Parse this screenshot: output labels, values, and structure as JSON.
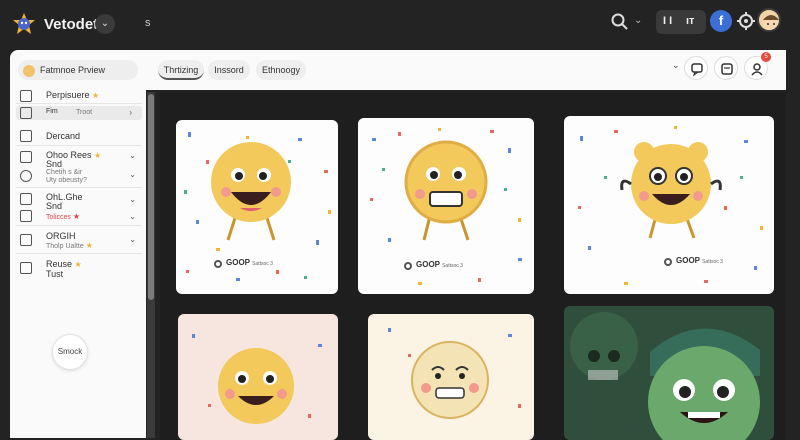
{
  "app": {
    "title": "Vetodet",
    "chev": "⌄",
    "s_label": "s"
  },
  "topbar": {
    "ii": "I I",
    "tt": "ıт",
    "fb": "f"
  },
  "sidebar": {
    "profile_label": "Fatmnoe Prview",
    "items": [
      {
        "label": "Perpisuere",
        "star": "★"
      },
      {
        "label": "Fim",
        "sub": "Troot",
        "chev": "›"
      },
      {
        "label": "Dercand"
      },
      {
        "label": "Ohoo Rees",
        "star": "★",
        "line2": "Snd",
        "sub": "Chetih s &ir",
        "sub2": "Uty obeusty?",
        "chev": "⌄"
      },
      {
        "label": "OhL.Ghe",
        "line2": "Snd",
        "sub": "Tolicces",
        "sub_star": "★",
        "chev": "⌄"
      },
      {
        "label": "ORGIH",
        "sub": "Tholp Ualtte",
        "sub_star": "★",
        "chev": "⌄"
      },
      {
        "label": "Reuse",
        "star": "★",
        "line2": "Tust"
      }
    ],
    "fab_label": "Smock"
  },
  "main": {
    "tabs": [
      "Thrtizing",
      "Inssord",
      "Ethnoogy"
    ],
    "chev": "⌄"
  },
  "cards": [
    {
      "label": "GOOP",
      "sub": "Sattsoc 3"
    },
    {
      "label": "GOOP",
      "sub": "Sattsoc 3"
    },
    {
      "label": "GOOP",
      "sub": "Sattsoc 3"
    }
  ],
  "badge": "5",
  "colors": {
    "accent": "#3b6fd6",
    "emoji": "#f2c95a",
    "badge": "#e44a3d"
  }
}
